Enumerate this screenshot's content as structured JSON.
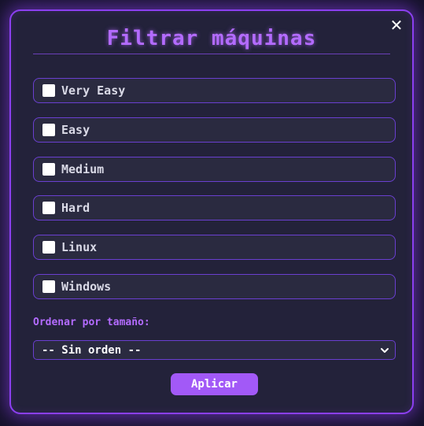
{
  "modal": {
    "title": "Filtrar máquinas",
    "close_icon": "close-icon",
    "filters": [
      {
        "label": "Very Easy",
        "checked": false
      },
      {
        "label": "Easy",
        "checked": false
      },
      {
        "label": "Medium",
        "checked": false
      },
      {
        "label": "Hard",
        "checked": false
      },
      {
        "label": "Linux",
        "checked": false
      },
      {
        "label": "Windows",
        "checked": false
      }
    ],
    "sort_label": "Ordenar por tamaño:",
    "sort_selected": "-- Sin orden --",
    "apply_label": "Aplicar"
  },
  "colors": {
    "accent": "#b36bff",
    "border": "#8b3ff0",
    "panel": "#23223a",
    "button": "#a259f7"
  }
}
